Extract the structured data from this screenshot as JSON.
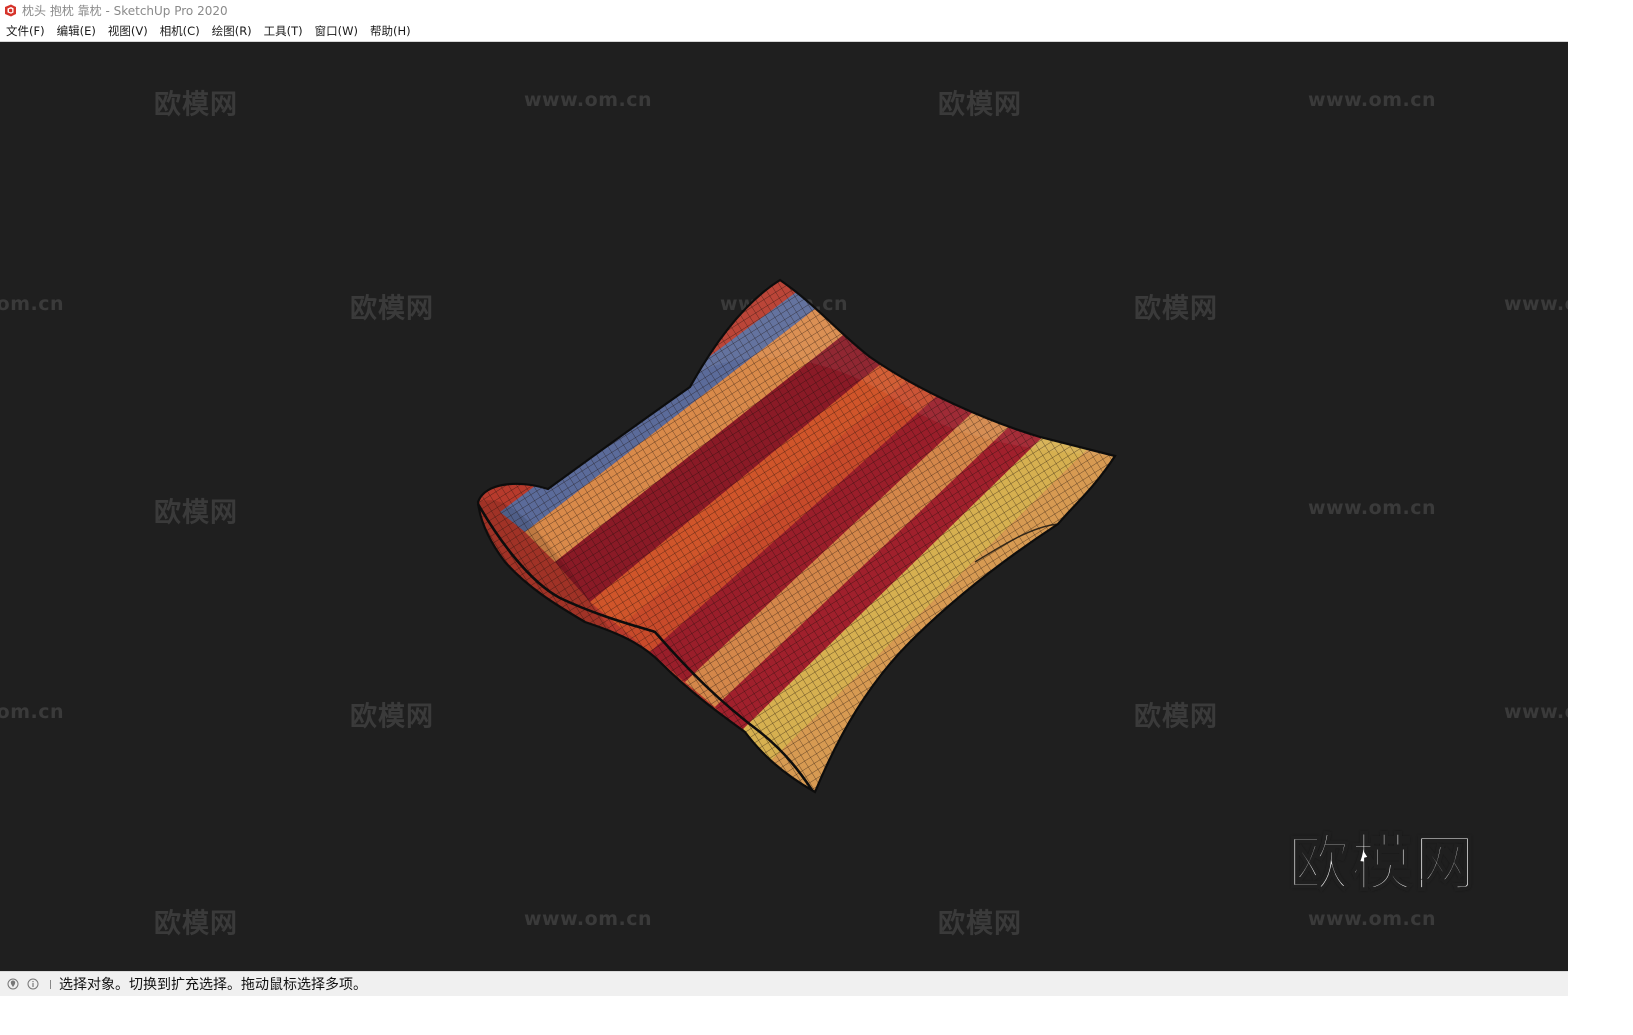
{
  "window": {
    "title": "枕头 抱枕 靠枕 - SketchUp Pro 2020",
    "icon": "sketchup-logo-icon"
  },
  "menu": [
    {
      "id": "file",
      "label": "文件(F)"
    },
    {
      "id": "edit",
      "label": "编辑(E)"
    },
    {
      "id": "view",
      "label": "视图(V)"
    },
    {
      "id": "camera",
      "label": "相机(C)"
    },
    {
      "id": "draw",
      "label": "绘图(R)"
    },
    {
      "id": "tools",
      "label": "工具(T)"
    },
    {
      "id": "window",
      "label": "窗口(W)"
    },
    {
      "id": "help",
      "label": "帮助(H)"
    }
  ],
  "viewport": {
    "background": "#1f1f1f",
    "watermark_text": "欧模网",
    "watermark_url": "www.om.cn",
    "logo_text": "欧模网",
    "model": {
      "name": "striped pillow",
      "stripe_colors": [
        "#b73a2c",
        "#5b6b9a",
        "#d98a4a",
        "#8a1a26",
        "#d0552a",
        "#c84a2a",
        "#9a1e2a",
        "#d4874a",
        "#a0202c",
        "#d6b050",
        "#d79a52"
      ]
    }
  },
  "statusbar": {
    "text": "选择对象。切换到扩充选择。拖动鼠标选择多项。",
    "icons": [
      "geo-location-icon",
      "info-icon"
    ]
  }
}
